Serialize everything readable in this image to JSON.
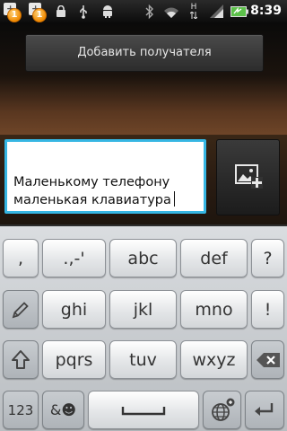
{
  "status_bar": {
    "notification_badges": [
      "1",
      "1"
    ],
    "icons": [
      "sd-card-notification-icon",
      "sd-card-notification-icon",
      "lock-bag-icon",
      "usb-icon",
      "android-debug-icon",
      "bluetooth-icon",
      "wifi-icon",
      "network-h-icon",
      "signal-icon",
      "battery-charging-icon"
    ],
    "network_type": "H",
    "time": "8:39"
  },
  "recipient": {
    "button_label": "Добавить получателя"
  },
  "compose": {
    "message_lines": [
      "Маленькому телефону",
      "маленькая клавиатура"
    ],
    "attach_icon": "image-attach-icon",
    "accent_color": "#36b6e3"
  },
  "keyboard": {
    "row1": [
      ",",
      ".,-'",
      "abc",
      "def",
      "?"
    ],
    "row2": [
      "ghi",
      "jkl",
      "mno",
      "!"
    ],
    "row3": [
      "pqrs",
      "tuv",
      "wxyz"
    ],
    "row4": [
      "123",
      "&☻"
    ],
    "icons": [
      "pencil-icon",
      "shift-icon",
      "backspace-icon",
      "space-icon",
      "globe-settings-icon",
      "enter-icon"
    ]
  }
}
